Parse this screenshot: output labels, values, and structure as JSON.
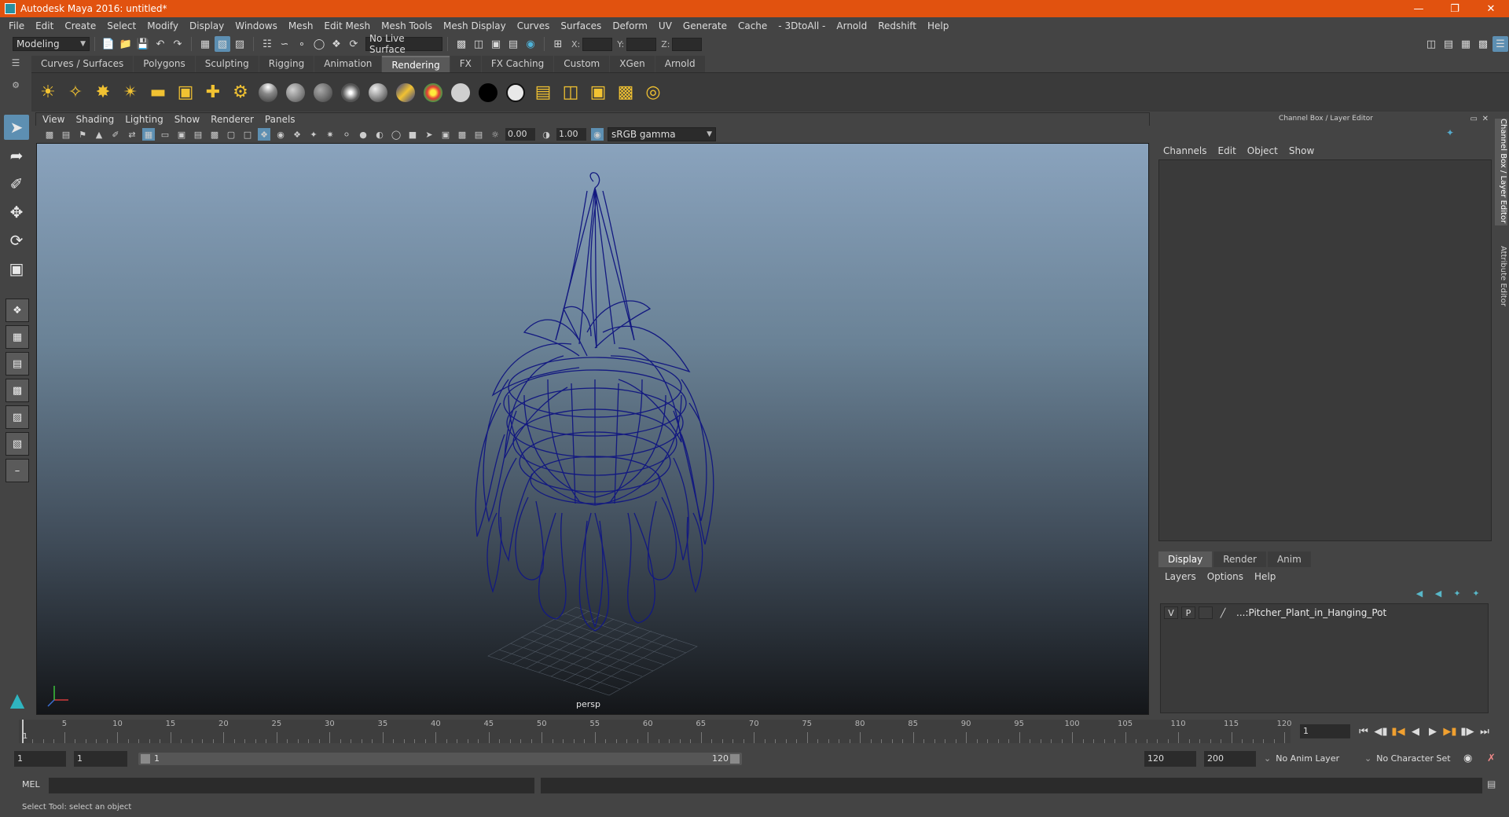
{
  "window": {
    "title": "Autodesk Maya 2016: untitled*"
  },
  "menu": [
    "File",
    "Edit",
    "Create",
    "Select",
    "Modify",
    "Display",
    "Windows",
    "Mesh",
    "Edit Mesh",
    "Mesh Tools",
    "Mesh Display",
    "Curves",
    "Surfaces",
    "Deform",
    "UV",
    "Generate",
    "Cache",
    "- 3DtoAll -",
    "Arnold",
    "Redshift",
    "Help"
  ],
  "status": {
    "mode": "Modeling",
    "live_surface": "No Live Surface",
    "x_label": "X:",
    "y_label": "Y:",
    "z_label": "Z:"
  },
  "shelf_tabs": [
    "Curves / Surfaces",
    "Polygons",
    "Sculpting",
    "Rigging",
    "Animation",
    "Rendering",
    "FX",
    "FX Caching",
    "Custom",
    "XGen",
    "Arnold"
  ],
  "shelf_active": "Rendering",
  "viewport": {
    "menus": [
      "View",
      "Shading",
      "Lighting",
      "Show",
      "Renderer",
      "Panels"
    ],
    "exposure": "0.00",
    "gamma": "1.00",
    "color_space": "sRGB gamma",
    "camera_label": "persp",
    "wire_color": "#131980"
  },
  "channel_box": {
    "header": "Channel Box / Layer Editor",
    "menus": [
      "Channels",
      "Edit",
      "Object",
      "Show"
    ]
  },
  "layer_editor": {
    "tabs": [
      "Display",
      "Render",
      "Anim"
    ],
    "active_tab": "Display",
    "menus": [
      "Layers",
      "Options",
      "Help"
    ],
    "layer": {
      "v": "V",
      "p": "P",
      "name": "...:Pitcher_Plant_in_Hanging_Pot"
    }
  },
  "side_tabs": [
    "Channel Box / Layer Editor",
    "Attribute Editor"
  ],
  "timeline": {
    "ticks": [
      5,
      10,
      15,
      20,
      25,
      30,
      35,
      40,
      45,
      50,
      55,
      60,
      65,
      70,
      75,
      80,
      85,
      90,
      95,
      100,
      105,
      110,
      115,
      120
    ],
    "start_label": "1",
    "current_frame": "1"
  },
  "range": {
    "start": "1",
    "playback_start": "1",
    "range_start": "1",
    "range_end": "120",
    "playback_end": "120",
    "end": "200",
    "anim_layer": "No Anim Layer",
    "character_set": "No Character Set"
  },
  "command": {
    "language": "MEL"
  },
  "help_line": "Select Tool: select an object"
}
